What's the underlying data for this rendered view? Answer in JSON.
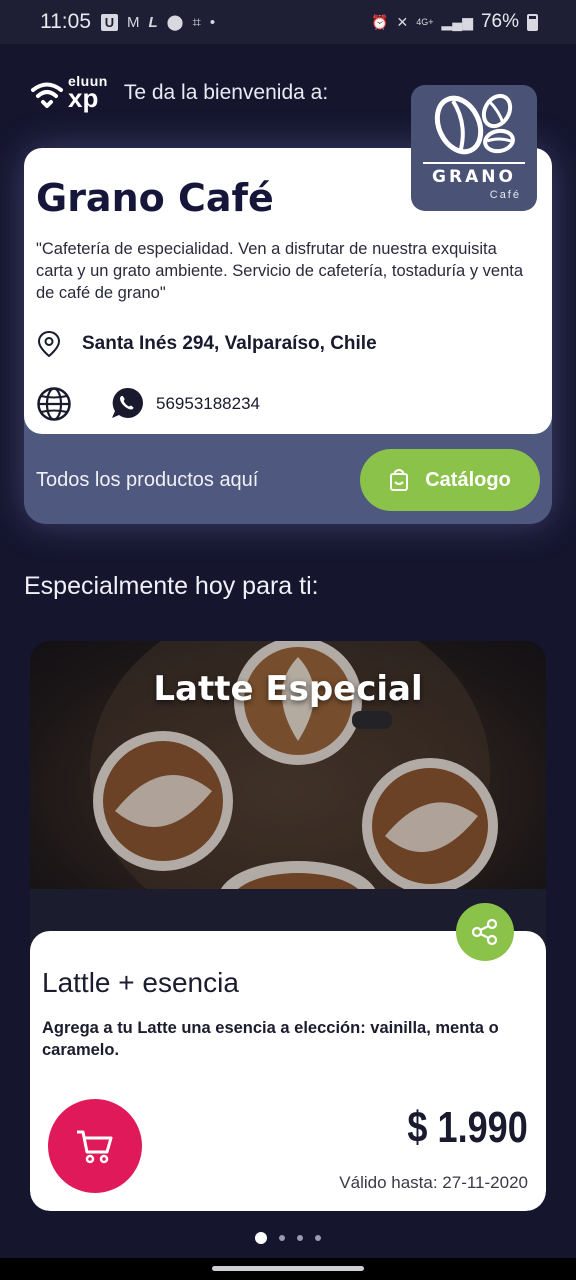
{
  "status_bar": {
    "time": "11:05",
    "left_icons": [
      "u-box-icon",
      "gmail-icon",
      "l-icon",
      "location-icon",
      "screenshot-icon",
      "dot-icon"
    ],
    "network": "4G+",
    "battery": "76%"
  },
  "header": {
    "brand_top": "eluun",
    "brand_bottom": "xp",
    "welcome": "Te da la bienvenida a:"
  },
  "business": {
    "name": "Grano Café",
    "description": "\"Cafetería de especialidad. Ven a disfrutar de nuestra exquisita carta y un grato ambiente. Servicio de cafetería, tostaduría y venta de café de grano\"",
    "address": "Santa Inés 294, Valparaíso, Chile",
    "phone": "56953188234",
    "logo_text": "GRANO",
    "logo_subtext": "Café",
    "catalog_prompt": "Todos los productos aquí",
    "catalog_button": "Catálogo"
  },
  "section": {
    "title": "Especialmente hoy para ti:"
  },
  "promo": {
    "image_title": "Latte Especial",
    "product_name": "Lattle + esencia",
    "description": "Agrega a tu Latte una esencia a elección: vainilla, menta o caramelo.",
    "price": "$ 1.990",
    "valid_until": "Válido hasta: 27-11-2020"
  },
  "pagination": {
    "pages": 4,
    "active": 0
  },
  "colors": {
    "background": "#15152e",
    "card_footer": "#4f587e",
    "accent_green": "#8bc34a",
    "cart_pink": "#e0195a"
  }
}
